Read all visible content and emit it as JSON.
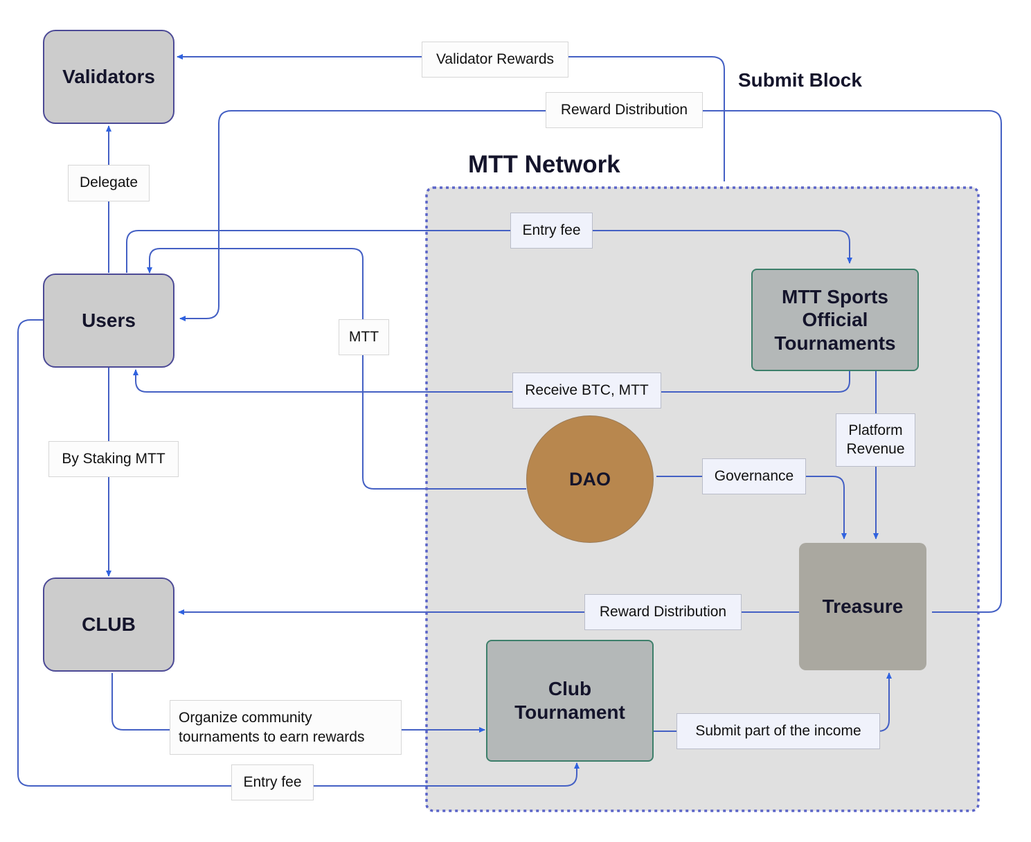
{
  "diagram": {
    "title": "MTT Network",
    "side_heading": "Submit Block",
    "colors": {
      "edge": "#4460c4",
      "arrow_head": "#2f62e0",
      "container_border": "#5a64c8",
      "container_fill": "#e0e0e0",
      "actor_fill": "#cccccc",
      "actor_border": "#4c4a96",
      "tournament_fill": "#b4b8b8",
      "tournament_border": "#3d7f6a",
      "treasure_fill": "#aaa8a0",
      "dao_fill": "#b8874e"
    },
    "nodes": {
      "validators": "Validators",
      "users": "Users",
      "club": "CLUB",
      "mtt_official": "MTT Sports Official Tournaments",
      "dao": "DAO",
      "treasure": "Treasure",
      "club_tournament": "Club Tournament"
    },
    "edge_labels": {
      "validator_rewards": "Validator Rewards",
      "reward_distribution_top": "Reward Distribution",
      "delegate": "Delegate",
      "entry_fee_official": "Entry fee",
      "mtt": "MTT",
      "receive_btc_mtt": "Receive BTC, MTT",
      "platform_revenue": "Platform Revenue",
      "by_staking_mtt": "By Staking MTT",
      "governance": "Governance",
      "reward_distribution_club": "Reward Distribution",
      "organize_community": "Organize community tournaments to earn rewards",
      "submit_income": "Submit part of the income",
      "entry_fee_club": "Entry fee"
    },
    "edges": [
      {
        "from": "Treasure",
        "to": "Validators",
        "label": "Validator Rewards"
      },
      {
        "from": "Validators",
        "to": "MTT Network",
        "label": "Submit Block"
      },
      {
        "from": "Treasure",
        "to": "Users",
        "label": "Reward Distribution"
      },
      {
        "from": "Users",
        "to": "Validators",
        "label": "Delegate"
      },
      {
        "from": "Users",
        "to": "MTT Sports Official Tournaments",
        "label": "Entry fee"
      },
      {
        "from": "DAO",
        "to": "Users",
        "label": "MTT"
      },
      {
        "from": "MTT Sports Official Tournaments",
        "to": "Users",
        "label": "Receive BTC, MTT"
      },
      {
        "from": "MTT Sports Official Tournaments",
        "to": "Treasure",
        "label": "Platform Revenue"
      },
      {
        "from": "Users",
        "to": "CLUB",
        "label": "By Staking MTT"
      },
      {
        "from": "DAO",
        "to": "Treasure",
        "label": "Governance"
      },
      {
        "from": "Treasure",
        "to": "CLUB",
        "label": "Reward Distribution"
      },
      {
        "from": "CLUB",
        "to": "Club Tournament",
        "label": "Organize community tournaments to earn rewards"
      },
      {
        "from": "Club Tournament",
        "to": "Treasure",
        "label": "Submit part of the income"
      },
      {
        "from": "Users",
        "to": "Club Tournament",
        "label": "Entry fee"
      }
    ]
  }
}
